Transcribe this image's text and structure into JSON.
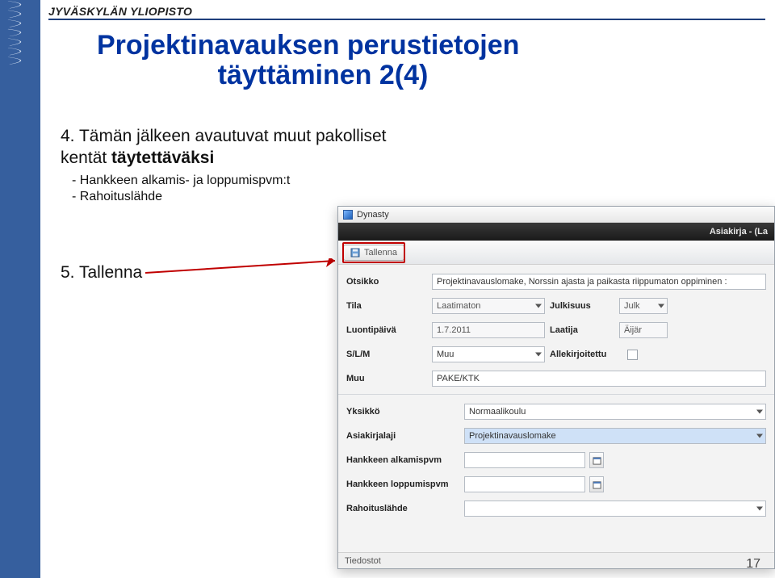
{
  "header": {
    "org": "JYVÄSKYLÄN YLIOPISTO"
  },
  "title": {
    "line1": "Projektinavauksen perustietojen",
    "line2": "täyttäminen 2(4)"
  },
  "body": {
    "step4_label": "4. Tämän jälkeen avautuvat muut pakolliset kentät ",
    "step4_bold": "täytettäväksi",
    "bullets": [
      "Hankkeen alkamis- ja loppumispvm:t",
      "Rahoituslähde"
    ],
    "step5": "5. Tallenna"
  },
  "app": {
    "title": "Dynasty",
    "darkbar": "Asiakirja - (La",
    "save_label": "Tallenna",
    "top": {
      "otsikko_label": "Otsikko",
      "otsikko_value": "Projektinavauslomake, Norssin ajasta ja paikasta riippumaton oppiminen :",
      "tila_label": "Tila",
      "tila_value": "Laatimaton",
      "julkisuus_label": "Julkisuus",
      "julkisuus_value": "Julk",
      "luontipaiva_label": "Luontipäivä",
      "luontipaiva_value": "1.7.2011",
      "laatija_label": "Laatija",
      "laatija_value": "Äijär",
      "slm_label": "S/L/M",
      "slm_value": "Muu",
      "allek_label": "Allekirjoitettu",
      "muu_label": "Muu",
      "muu_value": "PAKE/KTK"
    },
    "bottom": {
      "yksikko_label": "Yksikkö",
      "yksikko_value": "Normaalikoulu",
      "asiakirjalaji_label": "Asiakirjalaji",
      "asiakirjalaji_value": "Projektinavauslomake",
      "alkamis_label": "Hankkeen alkamispvm",
      "loppumis_label": "Hankkeen loppumispvm",
      "rahoitus_label": "Rahoituslähde"
    },
    "footer": "Tiedostot"
  },
  "page_number": "17"
}
